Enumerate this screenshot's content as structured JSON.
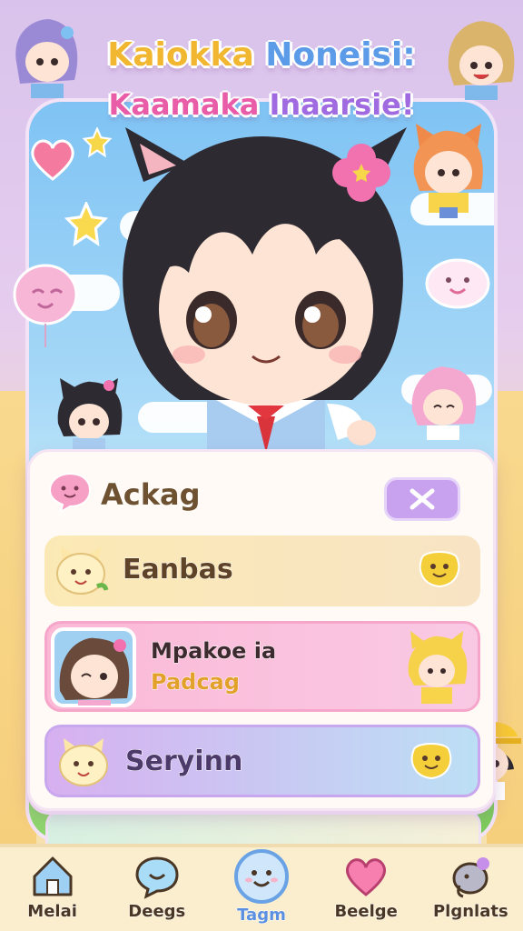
{
  "title": {
    "line1_a": "Kaiokka",
    "line1_b": "Noneisi:",
    "line2_a": "Kaamaka",
    "line2_b": "Inaarsie!"
  },
  "panel": {
    "header": {
      "label": "Ackag",
      "close_icon": "close-x-icon"
    },
    "items": [
      {
        "label": "Eanbas",
        "icon": "cat-face-icon",
        "trailing_icon": "smile-bubble-icon"
      },
      {
        "label": "Mpakoe ia",
        "sublabel": "Padcag",
        "icon": "avatar-girl",
        "trailing_icon": "chibi-blonde"
      },
      {
        "label": "Seryinn",
        "icon": "cat-face-icon",
        "trailing_icon": "smile-bubble-icon"
      }
    ]
  },
  "nav": [
    {
      "label": "Melai",
      "icon": "home-icon",
      "active": false
    },
    {
      "label": "Deegs",
      "icon": "chat-icon",
      "active": false
    },
    {
      "label": "Tagm",
      "icon": "smile-face-icon",
      "active": true
    },
    {
      "label": "Beelge",
      "icon": "heart-icon",
      "active": false
    },
    {
      "label": "Plgnlats",
      "icon": "elephant-icon",
      "active": false
    }
  ],
  "colors": {
    "background": "#e6cdee",
    "panel": "#fffaf5",
    "accent_pink": "#f9c9e4",
    "accent_purple": "#c8a2ee",
    "nav_bg": "#fbeecf"
  }
}
